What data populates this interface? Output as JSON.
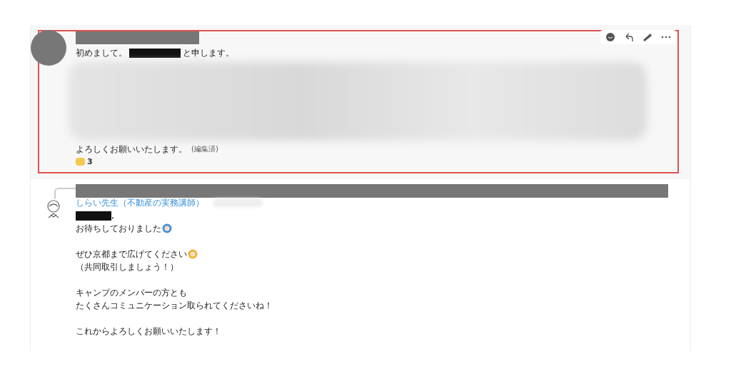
{
  "messages": [
    {
      "highlighted": true,
      "author_redacted": true,
      "lines": [
        [
          {
            "kind": "text",
            "text": "初めまして。"
          },
          {
            "kind": "redacted"
          },
          {
            "kind": "text",
            "text": "と申します。"
          }
        ],
        [
          {
            "kind": "blurred"
          }
        ],
        [
          {
            "kind": "text",
            "text": "よろしくお願いいたします。"
          },
          {
            "kind": "note",
            "text": "(編集済)"
          }
        ]
      ],
      "reactions": [
        {
          "color": "#f2c94c",
          "count": "3"
        }
      ],
      "toolbar": true
    },
    {
      "highlighted": false,
      "thread_reply": true,
      "author": "しらい先生（不動産の実務講師）",
      "paragraphs": [
        [
          [
            {
              "kind": "redacted"
            },
            {
              "kind": "text",
              "text": ","
            }
          ],
          [
            {
              "kind": "text",
              "text": "お待ちしておりました"
            },
            {
              "kind": "emoji",
              "color": "#4a90d9"
            }
          ]
        ],
        [
          [
            {
              "kind": "text",
              "text": "ぜひ京都まで広げてください"
            },
            {
              "kind": "emoji",
              "color": "#f2b233"
            }
          ],
          [
            {
              "kind": "text",
              "text": "（共同取引しましょう！）"
            }
          ]
        ],
        [
          [
            {
              "kind": "text",
              "text": "キャンプのメンバーの方とも"
            }
          ],
          [
            {
              "kind": "text",
              "text": "たくさんコミュニケーション取られてくださいね！"
            }
          ]
        ],
        [
          [
            {
              "kind": "text",
              "text": "これからよろしくお願いいたします！"
            }
          ]
        ]
      ]
    }
  ]
}
